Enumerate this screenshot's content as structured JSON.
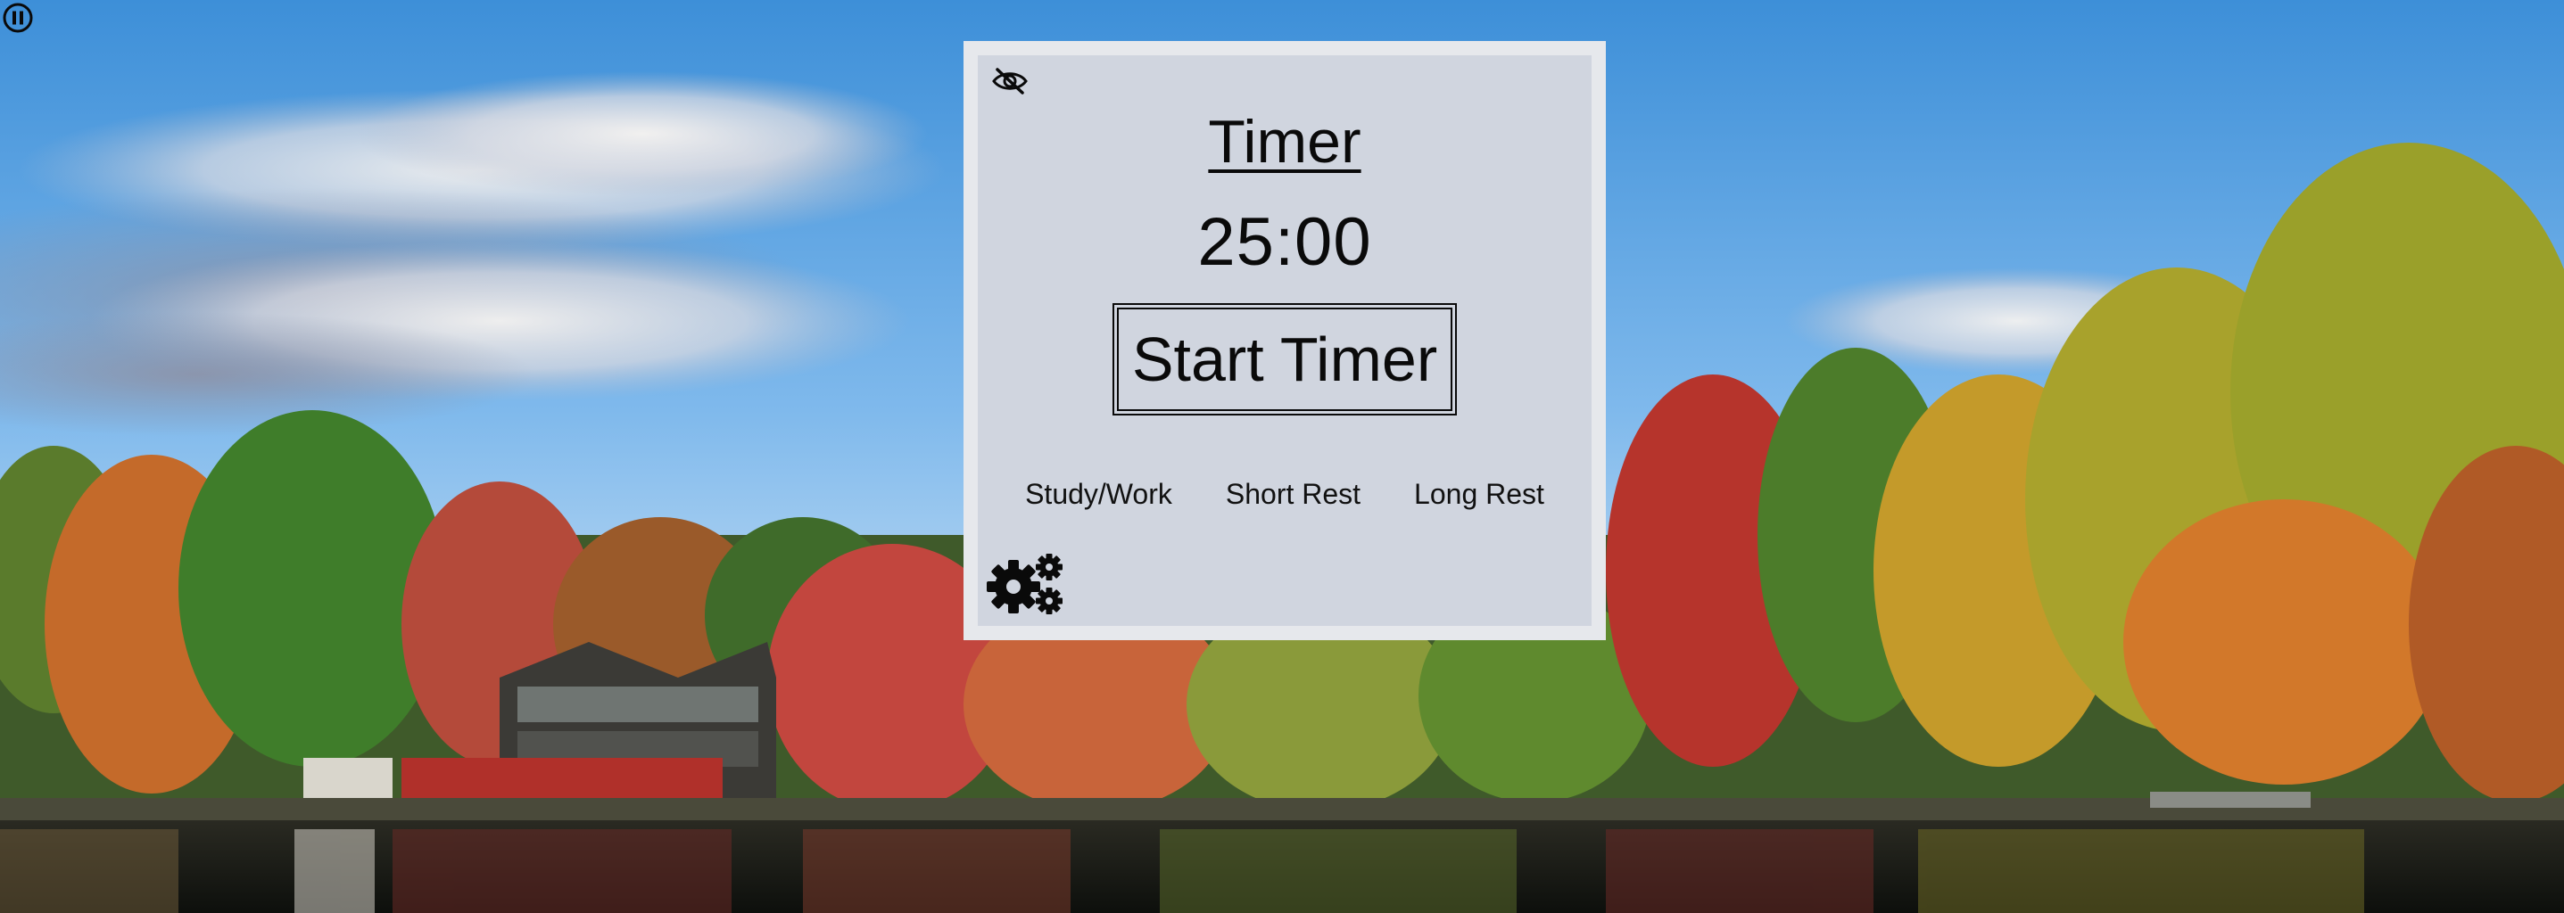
{
  "background": {
    "description_icon": "autumn-lake-scene"
  },
  "controls": {
    "pause_icon": "pause-icon"
  },
  "timer_panel": {
    "hide_icon": "eye-slash-icon",
    "title": "Timer",
    "time_display": "25:00",
    "start_label": "Start Timer",
    "modes": [
      {
        "label": "Study/Work"
      },
      {
        "label": "Short Rest"
      },
      {
        "label": "Long Rest"
      }
    ],
    "settings_icon": "gears-icon"
  },
  "colors": {
    "panel_border": "#e6e8ec",
    "panel_fill": "#d0d5df",
    "text": "#0a0a0a"
  }
}
